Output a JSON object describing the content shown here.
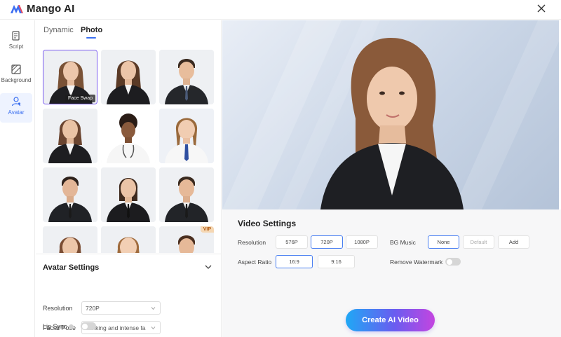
{
  "app": {
    "name": "Mango AI"
  },
  "sidebar": {
    "items": [
      {
        "label": "Script",
        "icon": "script-icon"
      },
      {
        "label": "Background",
        "icon": "background-icon"
      },
      {
        "label": "Avatar",
        "icon": "avatar-icon"
      }
    ],
    "active": "Avatar"
  },
  "tabs": [
    {
      "label": "Dynamic"
    },
    {
      "label": "Photo"
    }
  ],
  "active_tab": "Photo",
  "avatars": {
    "selected_badge": "Face Swap",
    "vip_badge": "VIP"
  },
  "avatar_settings": {
    "title": "Avatar Settings",
    "resolution_label": "Resolution",
    "resolution_value": "720P",
    "facial_pose_label": "Facial Pose",
    "facial_pose_value": "Blinking and intense fa",
    "lip_sync_label": "Lip Sync"
  },
  "video_settings": {
    "title": "Video Settings",
    "resolution_label": "Resolution",
    "resolution_options": [
      "576P",
      "720P",
      "1080P"
    ],
    "resolution_selected": "720P",
    "bg_music_label": "BG Music",
    "bg_music_options": [
      "None",
      "Default",
      "Add"
    ],
    "bg_music_selected": "None",
    "aspect_ratio_label": "Aspect Ratio",
    "aspect_ratio_options": [
      "16:9",
      "9:16"
    ],
    "aspect_ratio_selected": "16:9",
    "remove_watermark_label": "Remove Watermark"
  },
  "create_button": "Create AI Video",
  "colors": {
    "accent": "#3a6ff0",
    "selected_border": "#7b5cf0",
    "vip": "#f5d7b3"
  }
}
